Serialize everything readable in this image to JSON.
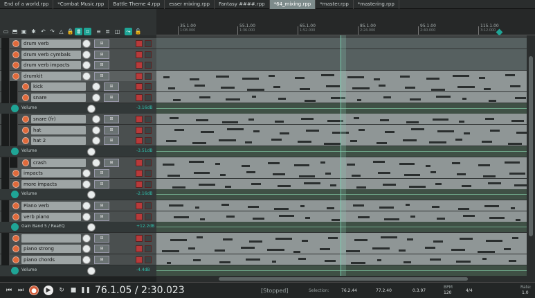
{
  "tabs": [
    {
      "label": "End of a world.rpp",
      "active": false
    },
    {
      "label": "*Combat Music.rpp",
      "active": false
    },
    {
      "label": "Battle Theme 4.rpp",
      "active": false
    },
    {
      "label": "esser mixing.rpp",
      "active": false
    },
    {
      "label": "Fantasy ####.rpp",
      "active": false
    },
    {
      "label": "*64_mixing.rpp",
      "active": true
    },
    {
      "label": "*master.rpp",
      "active": false
    },
    {
      "label": "*mastering.rpp",
      "active": false
    }
  ],
  "ruler": {
    "markers": [
      {
        "label": "35.1.00",
        "sub": "1:08.000"
      },
      {
        "label": "55.1.00",
        "sub": "1:36.000"
      },
      {
        "label": "65.1.00",
        "sub": "1:52.000"
      },
      {
        "label": "85.1.00",
        "sub": "2:24.000"
      },
      {
        "label": "95.1.00",
        "sub": "2:40.000"
      },
      {
        "label": "115.1.00",
        "sub": "3:12.000"
      }
    ]
  },
  "tracks": [
    {
      "name": "drum verb",
      "kind": "track",
      "depth": 0
    },
    {
      "name": "drum verb cymbals",
      "kind": "track",
      "depth": 0
    },
    {
      "name": "drum verb impacts",
      "kind": "track",
      "depth": 0
    },
    {
      "name": "drumkit",
      "kind": "folder",
      "depth": 0
    },
    {
      "name": "kick",
      "kind": "track",
      "depth": 1
    },
    {
      "name": "snare",
      "kind": "track",
      "depth": 1
    },
    {
      "name": "Volume",
      "kind": "env",
      "value": "-3.16dB"
    },
    {
      "name": "snare (fr)",
      "kind": "track",
      "depth": 1
    },
    {
      "name": "hat",
      "kind": "track",
      "depth": 1
    },
    {
      "name": "hat 2",
      "kind": "track",
      "depth": 1
    },
    {
      "name": "Volume",
      "kind": "env",
      "value": "-3.51dB"
    },
    {
      "name": "crash",
      "kind": "track",
      "depth": 1
    },
    {
      "name": "impacts",
      "kind": "track",
      "depth": 0
    },
    {
      "name": "more impacts",
      "kind": "track",
      "depth": 0
    },
    {
      "name": "Volume",
      "kind": "env",
      "value": "-2.16dB"
    },
    {
      "name": "Piano verb",
      "kind": "track",
      "depth": 0
    },
    {
      "name": "verb piano",
      "kind": "track",
      "depth": 0
    },
    {
      "name": "Gain Band 5 / ReaEQ",
      "kind": "env",
      "value": "+12.2dB"
    },
    {
      "name": "",
      "kind": "track",
      "depth": 0
    },
    {
      "name": "piano strong",
      "kind": "track",
      "depth": 0
    },
    {
      "name": "piano chords",
      "kind": "track",
      "depth": 0
    },
    {
      "name": "Volume",
      "kind": "env",
      "value": "-4.4dB"
    }
  ],
  "transport": {
    "time": "76.1.05 / 2:30.023",
    "status": "[Stopped]",
    "selection_label": "Selection:",
    "sel_start": "76.2.44",
    "sel_end": "77.2.40",
    "sel_len": "0.3.97",
    "bpm_label": "BPM",
    "bpm": "120",
    "timesig": "4/4",
    "rate_label": "Rate:",
    "rate": "1.0"
  },
  "icons": [
    "rewind-icon",
    "stop-icon",
    "record-icon",
    "play-icon",
    "repeat-icon",
    "pause-icon",
    "forward-icon"
  ]
}
